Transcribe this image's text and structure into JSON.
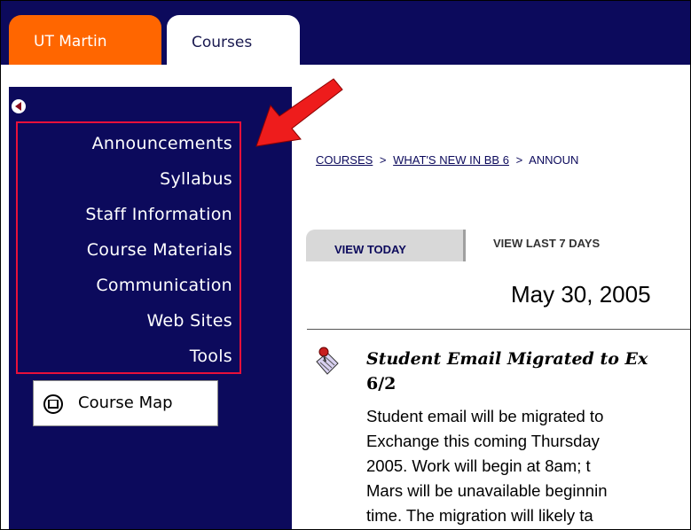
{
  "tabs": {
    "utm_label": "UT Martin",
    "courses_label": "Courses"
  },
  "sidebar": {
    "collapse_icon": "circle-left-arrow-icon",
    "menu_items": [
      {
        "label": "Announcements"
      },
      {
        "label": "Syllabus"
      },
      {
        "label": "Staff Information"
      },
      {
        "label": "Course Materials"
      },
      {
        "label": "Communication"
      },
      {
        "label": "Web Sites"
      },
      {
        "label": "Tools"
      }
    ],
    "course_map_label": "Course Map",
    "course_map_icon": "book-icon"
  },
  "breadcrumb": {
    "items": [
      "COURSES",
      "WHAT'S NEW IN BB 6",
      "ANNOUN"
    ],
    "separator": ">"
  },
  "view_tabs": {
    "today": "VIEW TODAY",
    "last7": "VIEW LAST 7 DAYS"
  },
  "date_heading": "May 30, 2005",
  "announcement": {
    "icon": "announcement-pin-icon",
    "title": "Student Email Migrated to Ex",
    "subtitle": "6/2",
    "body_lines": [
      "Student email will be migrated to",
      "Exchange this coming Thursday",
      "2005.  Work will begin at 8am; t",
      "Mars will be unavailable beginnin",
      "time.  The migration will likely ta"
    ]
  },
  "colors": {
    "navy": "#0c0a5c",
    "orange_tab": "#ff6600",
    "highlight_red": "#e8103a",
    "arrow_red": "#ee1c1c"
  }
}
